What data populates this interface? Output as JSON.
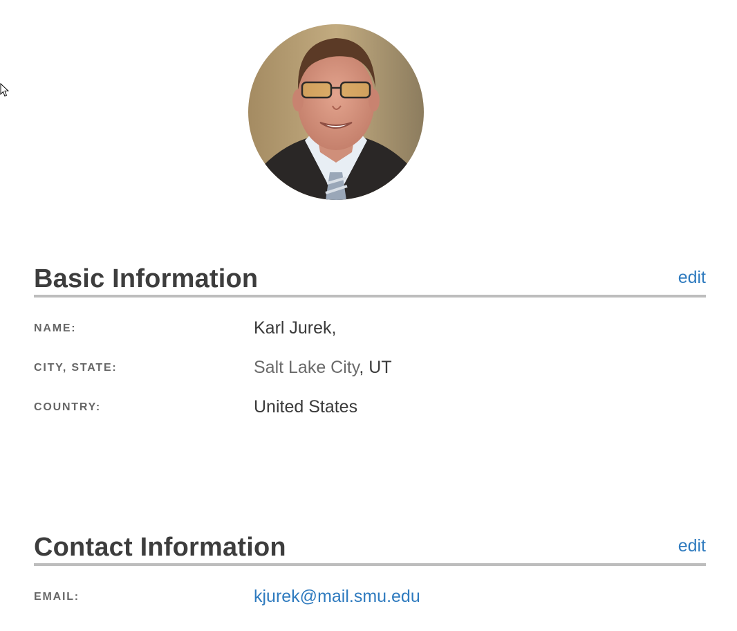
{
  "profile": {
    "photo": "profile-photo"
  },
  "basic": {
    "title": "Basic Information",
    "edit_label": "edit",
    "rows": [
      {
        "label": "NAME:",
        "value": "Karl Jurek,"
      },
      {
        "label": "CITY, STATE:",
        "city": "Salt Lake City",
        "state": ", UT"
      },
      {
        "label": "COUNTRY:",
        "value": "United States"
      }
    ]
  },
  "contact": {
    "title": "Contact Information",
    "edit_label": "edit",
    "rows": [
      {
        "label": "EMAIL:",
        "value": "kjurek@mail.smu.edu"
      }
    ]
  },
  "colors": {
    "link": "#2f7bbf",
    "rule": "#bdbdbd",
    "heading": "#3d3d3d",
    "label": "#666666"
  }
}
